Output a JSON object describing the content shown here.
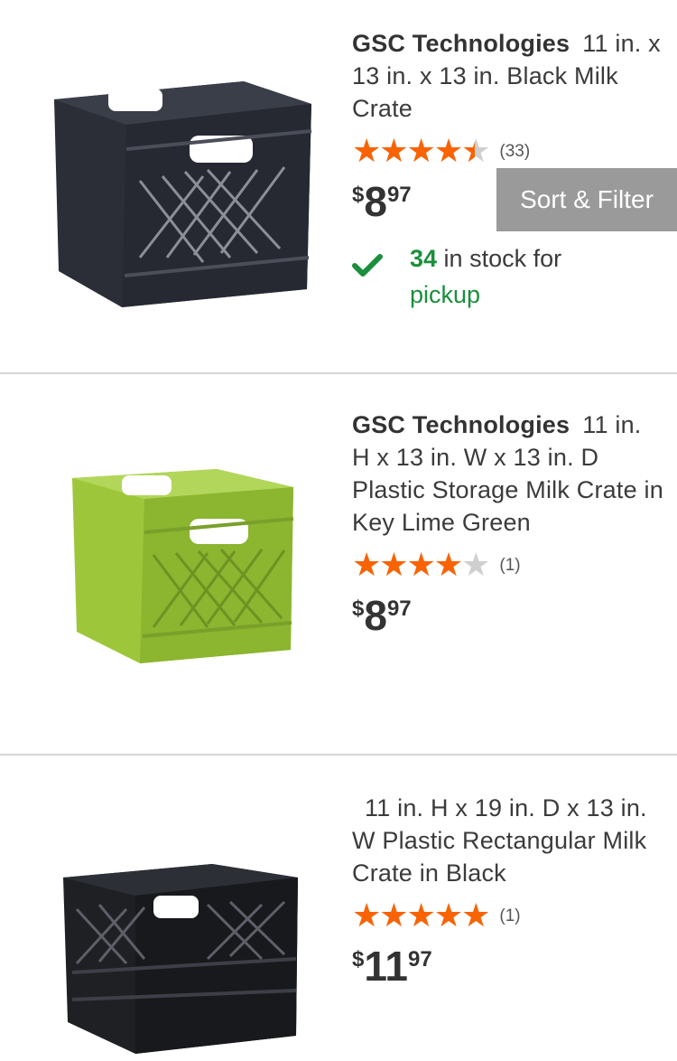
{
  "products": [
    {
      "brand": "GSC Technologies",
      "title": "11 in. x 13 in. x 13 in. Black Milk Crate",
      "rating": 4.5,
      "review_count": "(33)",
      "price": {
        "currency": "$",
        "dollars": "8",
        "cents": "97"
      },
      "stock": {
        "count": "34",
        "text": " in stock for ",
        "link": "pickup"
      },
      "image": "black-milk-crate"
    },
    {
      "brand": "GSC Technologies",
      "title": "11 in. H x 13 in. W x 13 in. D Plastic Storage Milk Crate in Key Lime Green",
      "rating": 4,
      "review_count": "(1)",
      "price": {
        "currency": "$",
        "dollars": "8",
        "cents": "97"
      },
      "image": "green-milk-crate"
    },
    {
      "brand": "",
      "title": "11 in. H x 19 in. D x 13 in. W Plastic Rectangular Milk Crate in Black",
      "rating": 5,
      "review_count": "(1)",
      "price": {
        "currency": "$",
        "dollars": "11",
        "cents": "97"
      },
      "image": "black-rectangular-crate"
    }
  ],
  "sort_filter_label": "Sort & Filter",
  "colors": {
    "star": "#f96302",
    "star_empty": "#cfcfcf",
    "stock_green": "#1a8f3c",
    "button_gray": "#9a9a9a",
    "crate_black": "#2b2e36",
    "crate_green": "#9dc63a"
  }
}
